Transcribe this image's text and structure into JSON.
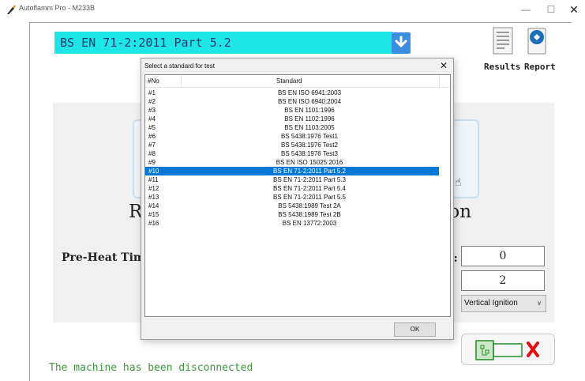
{
  "window": {
    "title": "Autoflamm Pro - M233B",
    "minimize_glyph": "—",
    "maximize_glyph": "☐",
    "close_glyph": "✕",
    "icon": "flame-brush-icon"
  },
  "standard_bar": {
    "selected": "BS EN 71-2:2011 Part 5.2",
    "background": "#1ee6e6",
    "dropdown_icon": "chevron-down-icon"
  },
  "toolbar": {
    "results_label": "Results",
    "report_label": "Report"
  },
  "main_panel": {
    "heading_left": "R",
    "heading_right": "ion",
    "preheat_label": "Pre-Heat Time",
    "paren_colon": "):",
    "field_1_value": "0",
    "field_2_value": "2",
    "ignition_select": "Vertical Ignition"
  },
  "status": {
    "text": "The machine has been disconnected",
    "color": "#3c9a3c"
  },
  "dialog": {
    "title": "Select a standard for test",
    "close_glyph": "✕",
    "columns": [
      "#No",
      "Standard"
    ],
    "rows": [
      {
        "no": "#1",
        "standard": "BS EN ISO 6941:2003"
      },
      {
        "no": "#2",
        "standard": "BS EN ISO 6940:2004"
      },
      {
        "no": "#3",
        "standard": "BS EN 1101:1996"
      },
      {
        "no": "#4",
        "standard": "BS EN 1102:1996"
      },
      {
        "no": "#5",
        "standard": "BS EN 1103:2005"
      },
      {
        "no": "#6",
        "standard": "BS 5438:1976 Test1"
      },
      {
        "no": "#7",
        "standard": "BS 5438:1976 Test2"
      },
      {
        "no": "#8",
        "standard": "BS 5438:1976 Test3"
      },
      {
        "no": "#9",
        "standard": "BS EN ISO 15025:2016"
      },
      {
        "no": "#10",
        "standard": "BS EN 71-2:2011 Part 5.2"
      },
      {
        "no": "#11",
        "standard": "BS EN 71-2:2011 Part 5.3"
      },
      {
        "no": "#12",
        "standard": "BS EN 71-2:2011 Part 5.4"
      },
      {
        "no": "#13",
        "standard": "BS EN 71-2:2011 Part 5.5"
      },
      {
        "no": "#14",
        "standard": "BS 5438:1989 Test 2A"
      },
      {
        "no": "#15",
        "standard": "BS 5438:1989 Test 2B"
      },
      {
        "no": "#16",
        "standard": "BS EN 13772:2003"
      }
    ],
    "selected_row": "#10",
    "selection_color": "#0078d7",
    "ok_label": "OK"
  }
}
